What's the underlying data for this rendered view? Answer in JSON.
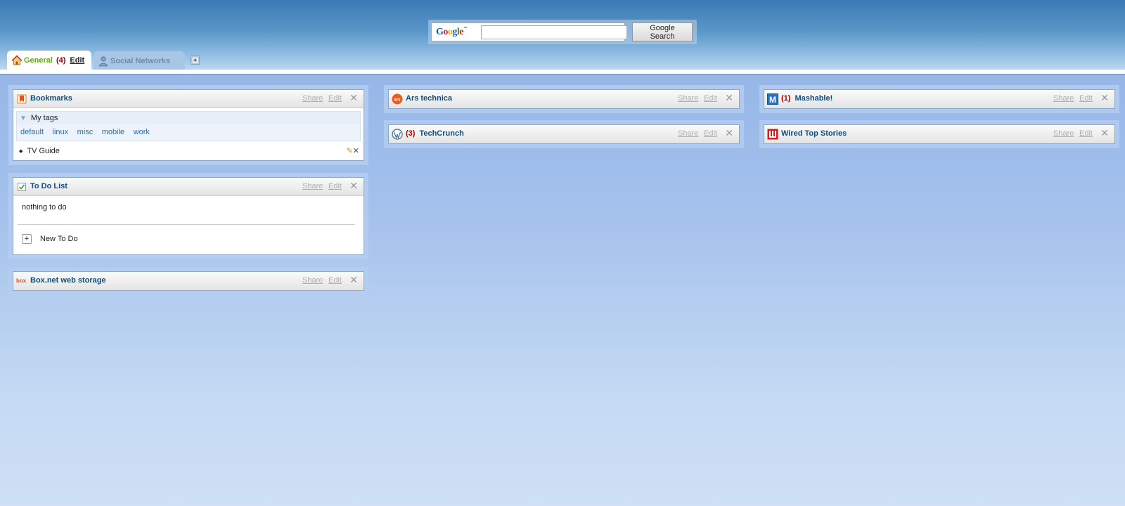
{
  "search": {
    "logo_text": "Google",
    "logo_tm": "™",
    "input_value": "",
    "button_label": "Google Search"
  },
  "tabs": [
    {
      "label": "General",
      "count": "(4)",
      "edit_label": "Edit",
      "active": true
    },
    {
      "label": "Social Networks",
      "active": false
    }
  ],
  "columns": {
    "left": {
      "bookmarks": {
        "title": "Bookmarks",
        "share": "Share",
        "edit": "Edit",
        "tags_heading": "My tags",
        "tags": [
          "default",
          "linux",
          "misc",
          "mobile",
          "work"
        ],
        "items": [
          "TV Guide"
        ]
      },
      "todo": {
        "title": "To Do List",
        "share": "Share",
        "edit": "Edit",
        "empty_text": "nothing to do",
        "new_label": "New To Do"
      },
      "box": {
        "title": "Box.net web storage",
        "icon_text": "box",
        "share": "Share",
        "edit": "Edit"
      }
    },
    "middle": {
      "ars": {
        "title": "Ars technica",
        "icon_text": "ars",
        "share": "Share",
        "edit": "Edit"
      },
      "techcrunch": {
        "title": "TechCrunch",
        "badge": "(3)",
        "share": "Share",
        "edit": "Edit"
      }
    },
    "right": {
      "mashable": {
        "title": "Mashable!",
        "badge": "(1)",
        "icon_text": "M",
        "share": "Share",
        "edit": "Edit"
      },
      "wired": {
        "title": "Wired Top Stories",
        "share": "Share",
        "edit": "Edit"
      }
    }
  },
  "colors": {
    "title_blue": "#0e4f7e",
    "badge_red": "#aa0000",
    "tab_green": "#5cae0c"
  }
}
